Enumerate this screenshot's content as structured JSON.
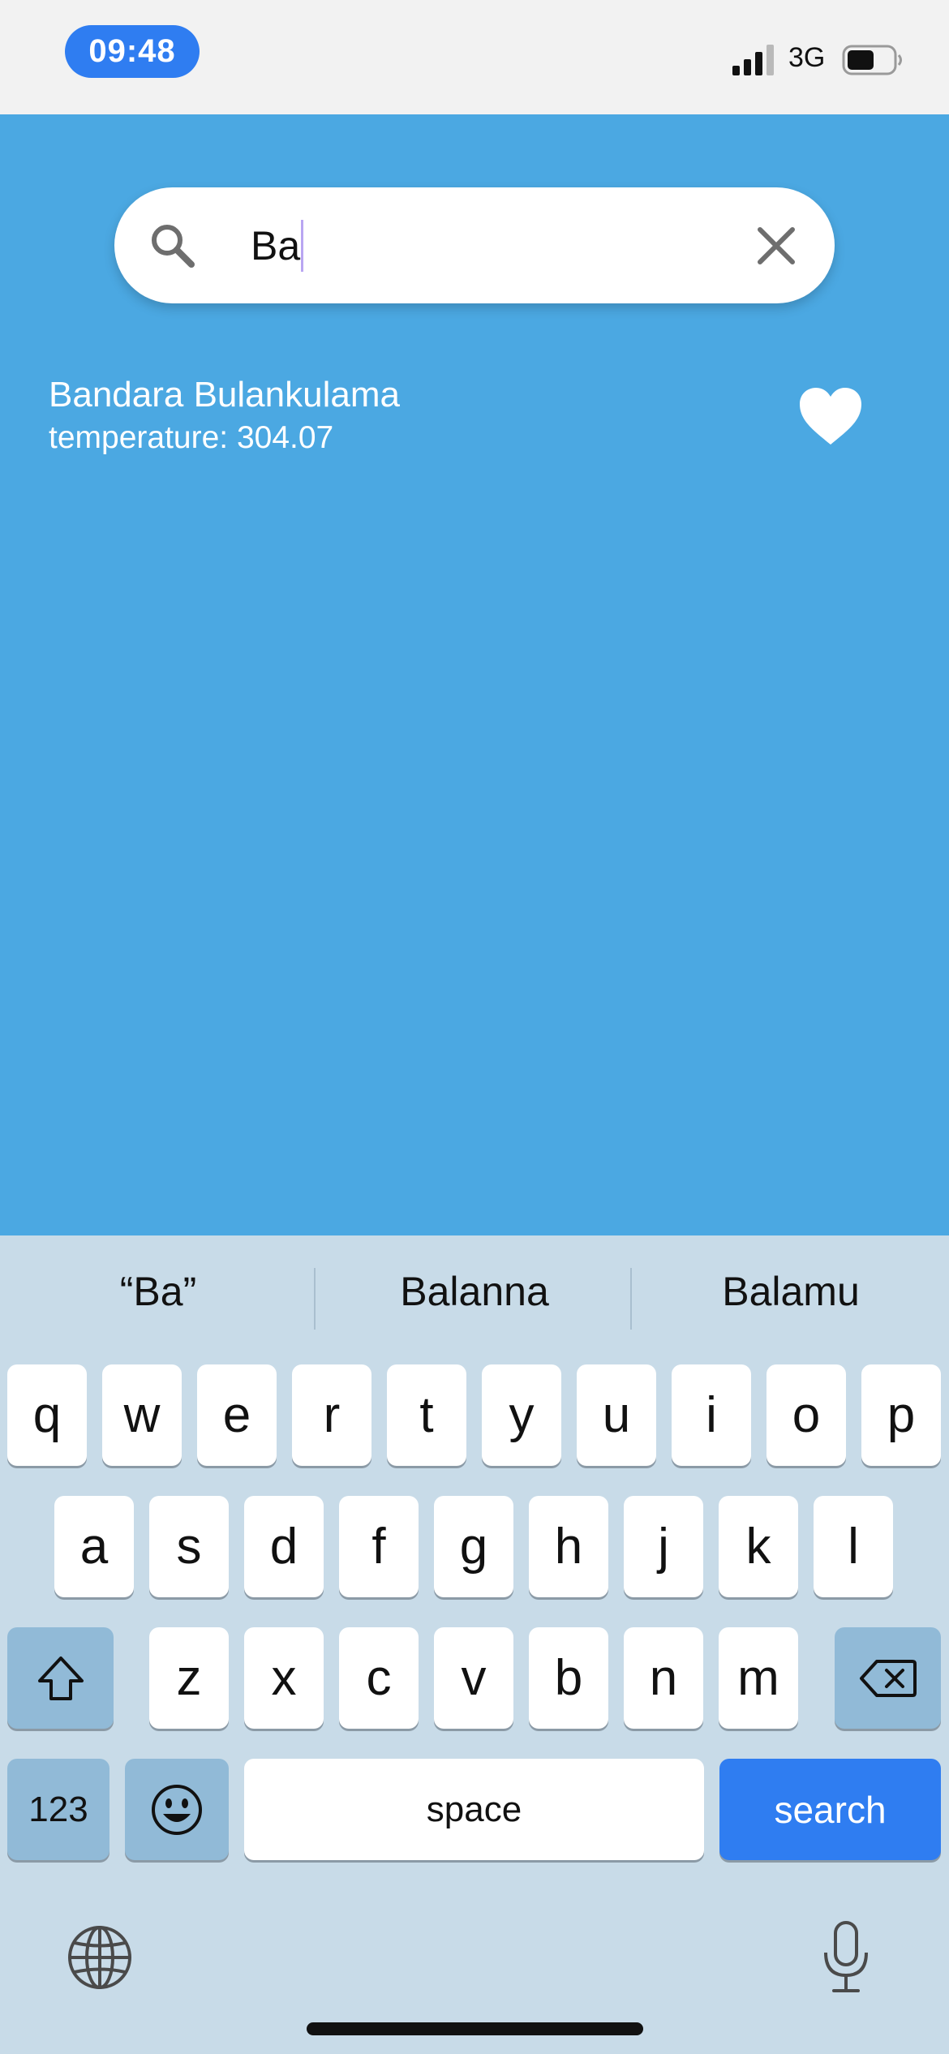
{
  "status_bar": {
    "time": "09:48",
    "network": "3G",
    "battery_level": 0.6
  },
  "search": {
    "value": "Ba",
    "icons": {
      "search": "search-icon",
      "clear": "close-icon"
    }
  },
  "results": [
    {
      "name": "Bandara Bulankulama",
      "detail": "temperature: 304.07",
      "favorite_icon": "heart-icon"
    }
  ],
  "keyboard": {
    "suggestions": [
      "“Ba”",
      "Balanna",
      "Balamu"
    ],
    "row1": [
      "q",
      "w",
      "e",
      "r",
      "t",
      "y",
      "u",
      "i",
      "o",
      "p"
    ],
    "row2": [
      "a",
      "s",
      "d",
      "f",
      "g",
      "h",
      "j",
      "k",
      "l"
    ],
    "row3": [
      "z",
      "x",
      "c",
      "v",
      "b",
      "n",
      "m"
    ],
    "numbers_label": "123",
    "space_label": "space",
    "action_label": "search",
    "colors": {
      "action": "#2f7df1",
      "background": "#c8dbe8"
    }
  },
  "colors": {
    "page_background": "#4ba8e2",
    "time_pill": "#2f7df1"
  }
}
